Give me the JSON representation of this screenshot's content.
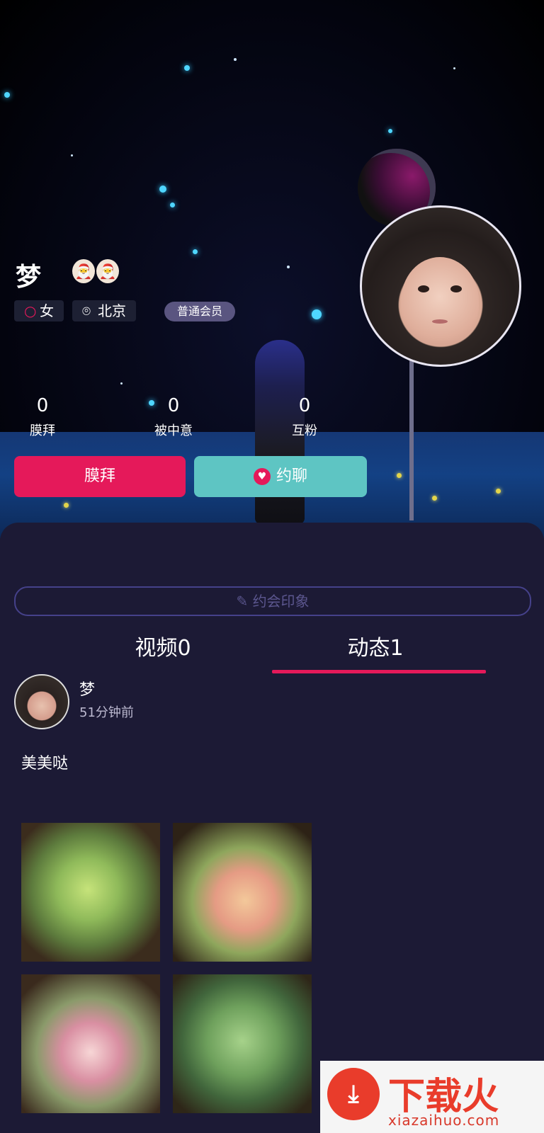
{
  "profile": {
    "name": "梦",
    "gender": "女",
    "location": "北京",
    "membership": "普通会员",
    "badges": [
      "🎅",
      "🎅"
    ]
  },
  "stats": [
    {
      "value": "0",
      "label": "膜拜"
    },
    {
      "value": "0",
      "label": "被中意"
    },
    {
      "value": "0",
      "label": "互粉"
    }
  ],
  "actions": {
    "worship_label": "膜拜",
    "chat_label": "约聊",
    "chat_icon": "heart-icon"
  },
  "impression": {
    "placeholder": "约会印象",
    "icon": "pencil-icon"
  },
  "tabs": [
    {
      "label": "视频0",
      "active": false
    },
    {
      "label": "动态1",
      "active": true
    }
  ],
  "post": {
    "author": "梦",
    "time": "51分钟前",
    "text": "美美哒",
    "photos": [
      "succulent-green",
      "succulent-pink",
      "succulent-rose",
      "succulent-jade"
    ]
  },
  "watermark": {
    "title": "下载火",
    "site": "xiazaihuo.com"
  },
  "colors": {
    "accent_pink": "#e5195a",
    "accent_teal": "#5ec5c3",
    "panel_bg": "#1c1a35",
    "member_tag": "#5a5580"
  }
}
